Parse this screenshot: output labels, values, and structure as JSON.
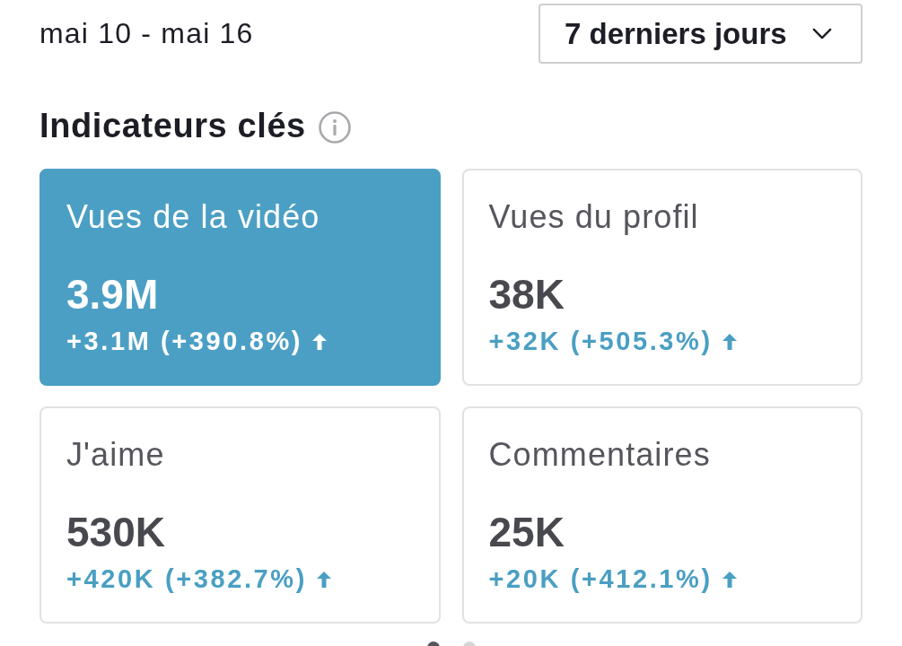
{
  "date_range": "mai 10 - mai 16",
  "period_dropdown": {
    "label": "7 derniers jours"
  },
  "section": {
    "title": "Indicateurs clés"
  },
  "metrics": [
    {
      "label": "Vues de la vidéo",
      "value": "3.9M",
      "change": "+3.1M (+390.8%)",
      "rising": true,
      "selected": true
    },
    {
      "label": "Vues du profil",
      "value": "38K",
      "change": "+32K (+505.3%)",
      "rising": true,
      "selected": false
    },
    {
      "label": "J'aime",
      "value": "530K",
      "change": "+420K (+382.7%)",
      "rising": true,
      "selected": false
    },
    {
      "label": "Commentaires",
      "value": "25K",
      "change": "+20K (+412.1%)",
      "rising": true,
      "selected": false
    }
  ],
  "pagination": [
    {
      "selected": true
    },
    {
      "selected": false
    }
  ]
}
